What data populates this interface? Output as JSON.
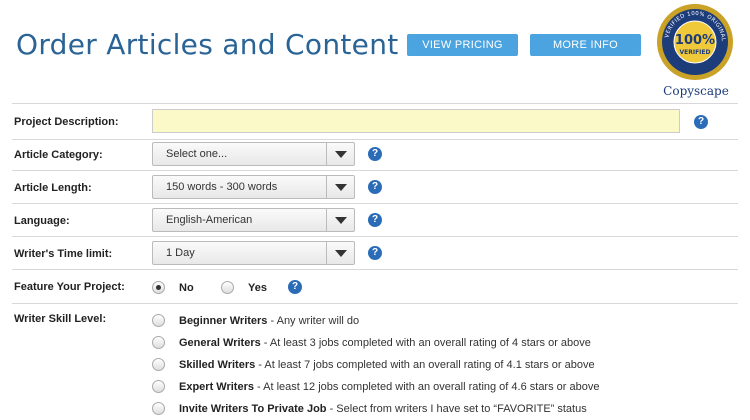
{
  "header": {
    "title": "Order Articles and Content",
    "pricing_label": "VIEW PRICING",
    "info_label": "MORE INFO",
    "seal": {
      "badge_text": "100%",
      "badge_sub": "VERIFIED",
      "ring_text": "VERIFIED 100% ORIGINAL COPYSCAPE.COM",
      "brand": "Copyscape"
    }
  },
  "form": {
    "project_description": {
      "label": "Project Description:",
      "value": ""
    },
    "category": {
      "label": "Article Category:",
      "value": "Select one..."
    },
    "length": {
      "label": "Article Length:",
      "value": "150 words - 300 words"
    },
    "language": {
      "label": "Language:",
      "value": "English-American"
    },
    "time_limit": {
      "label": "Writer's Time limit:",
      "value": "1 Day"
    },
    "feature": {
      "label": "Feature Your Project:",
      "no": "No",
      "yes": "Yes",
      "selected": "No"
    },
    "skill": {
      "label": "Writer Skill Level:",
      "options": [
        {
          "name": "Beginner Writers",
          "desc": " - Any writer will do"
        },
        {
          "name": "General Writers",
          "desc": " - At least 3 jobs completed with an overall rating of 4 stars or above"
        },
        {
          "name": "Skilled Writers",
          "desc": " - At least 7 jobs completed with an overall rating of 4.1 stars or above"
        },
        {
          "name": "Expert Writers",
          "desc": " - At least 12 jobs completed with an overall rating of 4.6 stars or above"
        },
        {
          "name": "Invite Writers To Private Job",
          "desc": " - Select from writers I have set to “FAVORITE” status"
        }
      ]
    },
    "help_glyph": "?"
  },
  "colors": {
    "title": "#2a6496",
    "button": "#4ba3e0",
    "help": "#2b6cb8",
    "input_bg": "#fcf9c9"
  }
}
